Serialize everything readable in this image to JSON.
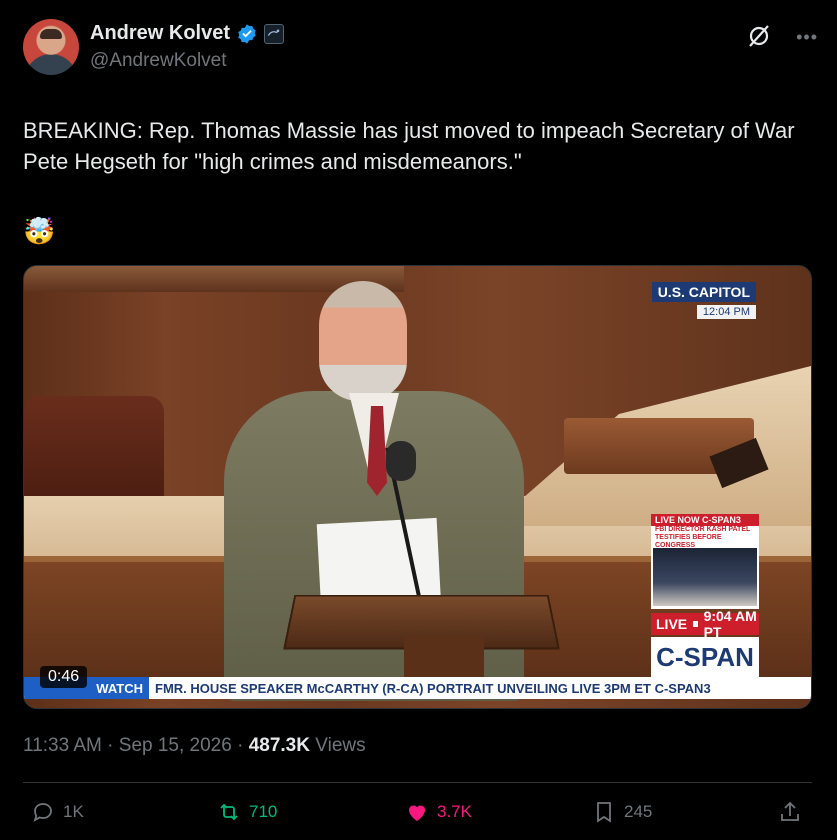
{
  "author": {
    "display_name": "Andrew Kolvet",
    "handle": "@AndrewKolvet"
  },
  "tweet": {
    "text": "BREAKING: Rep. Thomas Massie has just moved to impeach Secretary of War Pete Hegseth for \"high crimes and misdemeanors.\"",
    "emoji": "🤯"
  },
  "video": {
    "duration": "0:46",
    "bug_label": "U.S. CAPITOL",
    "bug_time": "12:04 PM",
    "promo_top": "LIVE NOW C-SPAN3",
    "promo_sub": "FBI DIRECTOR KASH PATEL TESTIFIES BEFORE CONGRESS",
    "live_label": "LIVE",
    "live_time": "9:04 AM PT",
    "logo": "C-SPAN",
    "ticker_tag": "WATCH",
    "ticker_text": "FMR. HOUSE SPEAKER McCARTHY (R-CA) PORTRAIT UNVEILING  LIVE 3PM ET C-SPAN3"
  },
  "meta": {
    "time": "11:33 AM",
    "date": "Sep 15, 2026",
    "views_count": "487.3K",
    "views_label": "Views"
  },
  "actions": {
    "replies": "1K",
    "reposts": "710",
    "likes": "3.7K",
    "bookmarks": "245"
  },
  "icons": {
    "verified": "verified-badge-icon",
    "affiliate": "affiliate-badge-icon",
    "grok": "grok-icon",
    "more": "more-icon",
    "reply": "reply-icon",
    "repost": "repost-icon",
    "like": "heart-icon",
    "bookmark": "bookmark-icon",
    "share": "share-icon"
  },
  "colors": {
    "background": "#000000",
    "text": "#e7e9ea",
    "muted": "#71767b",
    "verified_blue": "#1d9bf0",
    "repost_green": "#00ba7c",
    "like_pink": "#f91880"
  }
}
